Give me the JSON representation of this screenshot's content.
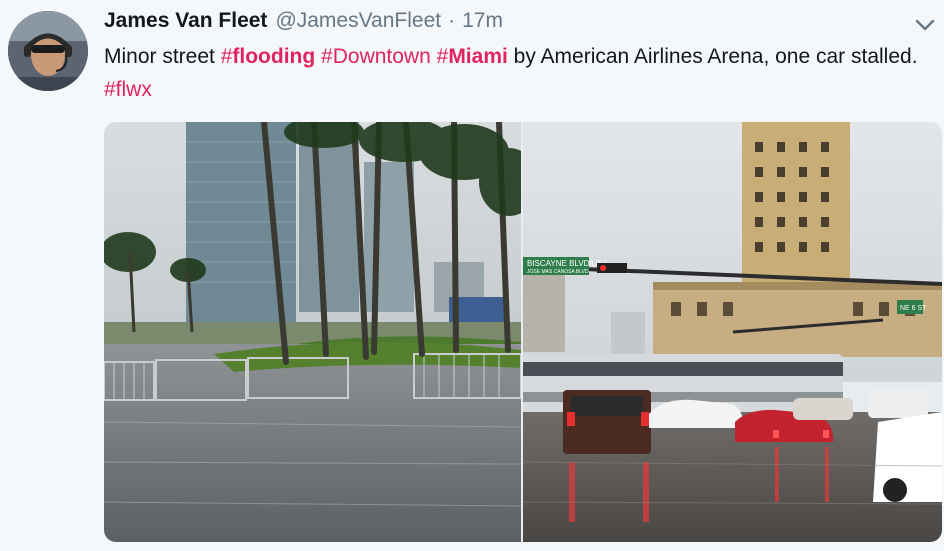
{
  "tweet": {
    "author_name": "James Van Fleet",
    "handle": "@JamesVanFleet",
    "separator": "·",
    "time": "17m",
    "text_parts": {
      "p1": "Minor street ",
      "h1_hash": "#",
      "h1_word": "flooding",
      "space1": " ",
      "h2": "#Downtown",
      "space2": " ",
      "h3_hash": "#",
      "h3_word": "Miami",
      "p2": " by American Airlines Arena, one car stalled. ",
      "h4": "#flwx"
    },
    "photos": [
      {
        "name": "flooded-park-photo"
      },
      {
        "name": "flooded-intersection-photo",
        "signs": {
          "street_sign": "BISCAYNE BLVD/US1",
          "street_sign_sub": "JOSE MAS CANOSA BLVD",
          "ne6_sign": "NE 6 ST"
        }
      }
    ]
  },
  "colors": {
    "hashtag": "#e0245e",
    "text": "#14171a",
    "secondary": "#657786",
    "background": "#f5f8fa"
  },
  "icons": {
    "more": "chevron-down-icon"
  }
}
